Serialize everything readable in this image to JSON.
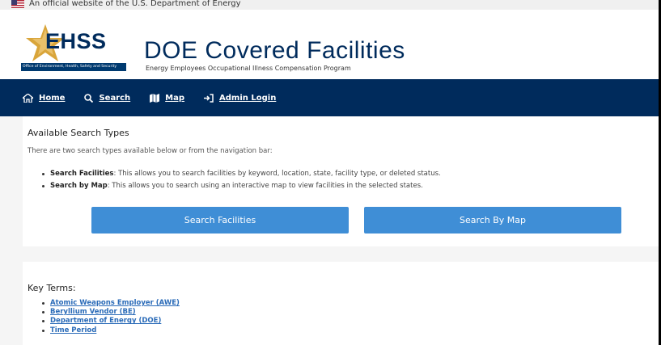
{
  "gov_banner": {
    "text": "An official website of the U.S. Department of Energy"
  },
  "header": {
    "logo_text": "EHSS",
    "logo_subtext": "Office of Environment, Health, Safety and Security",
    "title": "DOE Covered Facilities",
    "subtitle": "Energy Employees Occupational Illness Compensation Program"
  },
  "nav": {
    "items": [
      {
        "label": "Home",
        "icon": "home-icon"
      },
      {
        "label": "Search",
        "icon": "search-icon"
      },
      {
        "label": "Map",
        "icon": "map-icon"
      },
      {
        "label": "Admin Login",
        "icon": "login-icon"
      }
    ]
  },
  "search_types": {
    "title": "Available Search Types",
    "intro": "There are two search types available below or from the navigation bar:",
    "items": [
      {
        "label": "Search Facilities",
        "text": ": This allows you to search facilities by keyword, location, state, facility type, or deleted status."
      },
      {
        "label": "Search by Map",
        "text": ": This allows you to search using an interactive map to view facilities in the selected states."
      }
    ],
    "buttons": {
      "facilities": "Search Facilities",
      "map": "Search By Map"
    }
  },
  "key_terms": {
    "title": "Key Terms:",
    "links": [
      "Atomic Weapons Employer (AWE)",
      "Beryllium Vendor (BE)",
      "Department of Energy (DOE)",
      "Time Period"
    ]
  },
  "colors": {
    "navy": "#002b5c",
    "button_blue": "#3f8ed6",
    "link_blue": "#2a6bb8"
  }
}
